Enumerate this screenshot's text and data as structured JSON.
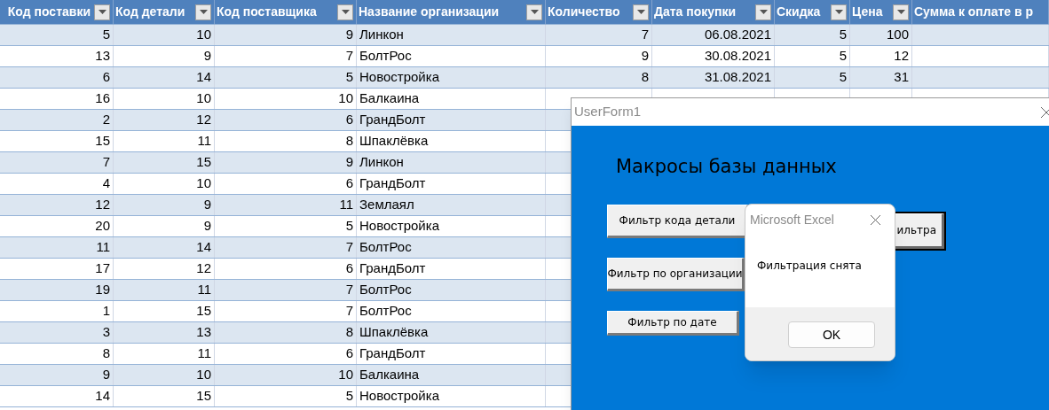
{
  "table": {
    "columns": [
      {
        "label": "Код поставки",
        "filter_button": true
      },
      {
        "label": "Код детали",
        "filter_button": true
      },
      {
        "label": "Код поставщика",
        "filter_button": true
      },
      {
        "label": "Название организации",
        "filter_button": true
      },
      {
        "label": "Количество",
        "filter_button": true
      },
      {
        "label": "Дата покупки",
        "filter_button": true
      },
      {
        "label": "Скидка",
        "filter_button": true
      },
      {
        "label": "Цена",
        "filter_button": true
      },
      {
        "label": "Сумма к оплате в р",
        "filter_button": false
      }
    ],
    "rows": [
      [
        "5",
        "10",
        "9",
        "Линкон",
        "7",
        "06.08.2021",
        "5",
        "100"
      ],
      [
        "13",
        "9",
        "7",
        "БолтРос",
        "9",
        "30.08.2021",
        "5",
        "12"
      ],
      [
        "6",
        "14",
        "5",
        "Новостройка",
        "8",
        "31.08.2021",
        "5",
        "31"
      ],
      [
        "16",
        "10",
        "10",
        "Балкаина"
      ],
      [
        "2",
        "12",
        "6",
        "ГрандБолт"
      ],
      [
        "15",
        "11",
        "8",
        "Шпаклёвка"
      ],
      [
        "7",
        "15",
        "9",
        "Линкон"
      ],
      [
        "4",
        "10",
        "6",
        "ГрандБолт"
      ],
      [
        "12",
        "9",
        "11",
        "Землаял"
      ],
      [
        "20",
        "9",
        "5",
        "Новостройка"
      ],
      [
        "11",
        "14",
        "7",
        "БолтРос"
      ],
      [
        "17",
        "12",
        "6",
        "ГрандБолт"
      ],
      [
        "19",
        "11",
        "7",
        "БолтРос"
      ],
      [
        "1",
        "15",
        "7",
        "БолтРос"
      ],
      [
        "3",
        "13",
        "8",
        "Шпаклёвка"
      ],
      [
        "8",
        "11",
        "6",
        "ГрандБолт"
      ],
      [
        "9",
        "10",
        "10",
        "Балкаина"
      ],
      [
        "14",
        "15",
        "5",
        "Новостройка"
      ]
    ]
  },
  "userform": {
    "title": "UserForm1",
    "heading": "Макросы базы данных",
    "buttons": [
      {
        "label": "Фильтр кода детали",
        "default": false
      },
      {
        "label": "Фильтр по организации",
        "default": false
      },
      {
        "label": "Фильтр по дате",
        "default": false
      },
      {
        "label": "ильтра",
        "default": true
      }
    ]
  },
  "message_box": {
    "title": "Microsoft Excel",
    "message": "Фильтрация снята",
    "button": "OK"
  }
}
